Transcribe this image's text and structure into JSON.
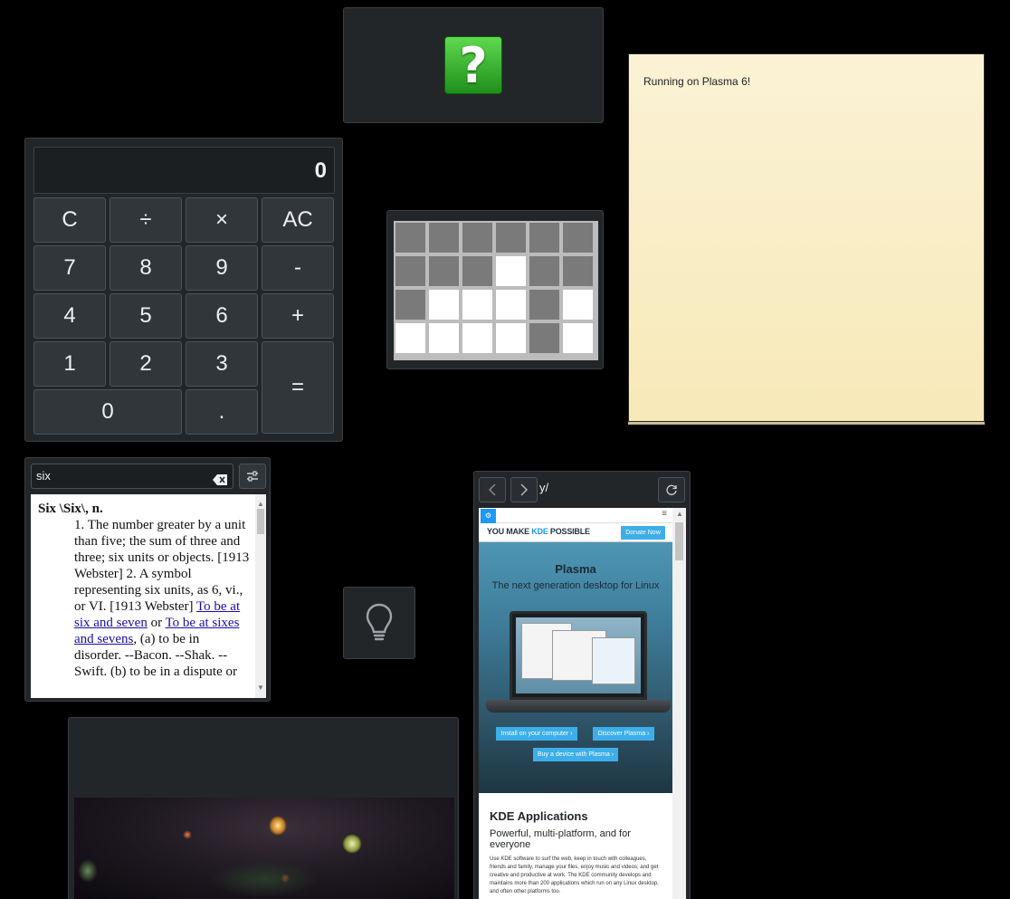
{
  "help": {
    "icon": "help-question-icon",
    "glyph": "?"
  },
  "note": {
    "text": "Running on Plasma 6!"
  },
  "calculator": {
    "display": "0",
    "keys": {
      "clear": "C",
      "divide": "÷",
      "multiply": "×",
      "all_clear": "AC",
      "seven": "7",
      "eight": "8",
      "nine": "9",
      "minus": "-",
      "four": "4",
      "five": "5",
      "six": "6",
      "plus": "+",
      "one": "1",
      "two": "2",
      "three": "3",
      "equals": "=",
      "zero": "0",
      "decimal": "."
    }
  },
  "puzzle": {
    "rows": [
      [
        0,
        0,
        0,
        0,
        0,
        0
      ],
      [
        0,
        0,
        0,
        1,
        0,
        0
      ],
      [
        0,
        1,
        1,
        1,
        0,
        1
      ],
      [
        1,
        1,
        1,
        1,
        0,
        1
      ]
    ]
  },
  "dictionary": {
    "query": "six",
    "headword": "Six \\Six\\, n.",
    "def_part1": "1. The number greater by a unit than five; the sum of three and three; six units or objects. [1913 Webster] 2. A symbol representing six units, as 6, vi., or VI. [1913 Webster] ",
    "link1": "To be at six and seven",
    "or": " or ",
    "link2": "To be at sixes and sevens",
    "def_part2": ", (a) to be in disorder. --Bacon. --Shak. --Swift. (b) to be in a dispute or"
  },
  "web": {
    "url_fragment": "y/",
    "tagline_you": "YOU ",
    "tagline_make": "MAKE ",
    "tagline_kde": "KDE ",
    "tagline_possible": "POSSIBLE",
    "donate": "Donate Now",
    "hero_title": "Plasma",
    "hero_subtitle": "The next generation desktop for Linux",
    "install_btn": "Install on your computer ›",
    "discover_btn": "Discover Plasma ›",
    "device_btn": "Buy a device with Plasma ›",
    "apps_title": "KDE Applications",
    "apps_subtitle": "Powerful, multi-platform, and for everyone",
    "apps_body": "Use KDE software to surf the web, keep in touch with colleagues, friends and family, manage your files, enjoy music and videos; and get creative and productive at work. The KDE community develops and maintains more than 200 applications which run on any Linux desktop, and often other platforms too."
  },
  "colors": {
    "widget_bg": "#232629",
    "accent": "#3daee9",
    "note_bg": "#fbf2d6"
  }
}
